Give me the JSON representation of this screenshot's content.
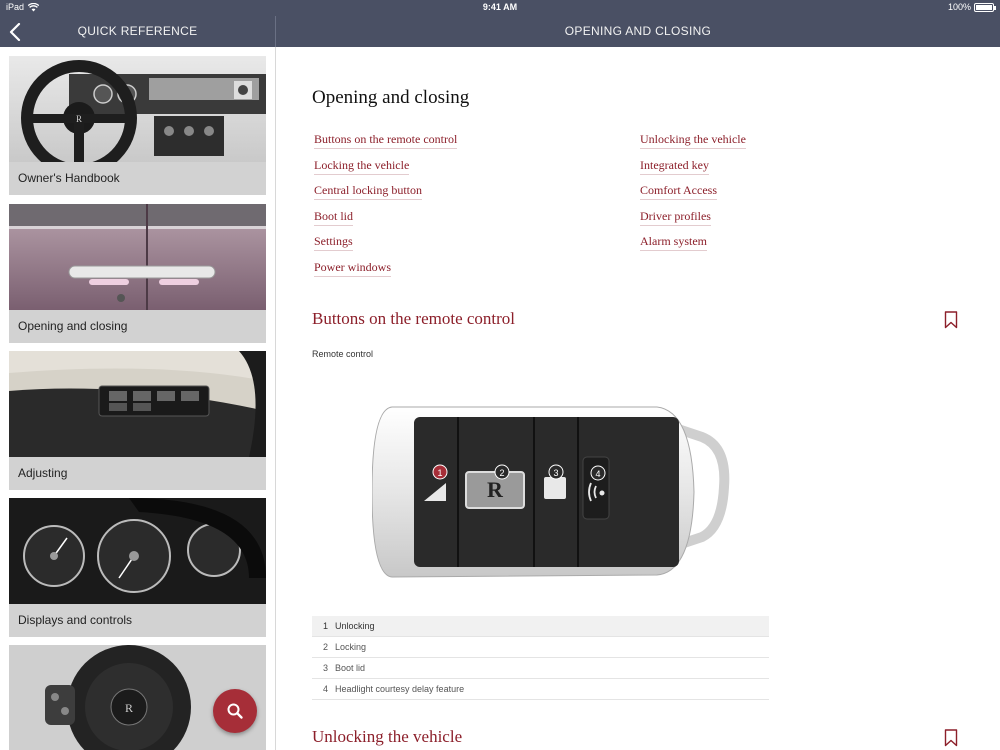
{
  "status_bar": {
    "carrier": "iPad",
    "time": "9:41 AM",
    "battery": "100%"
  },
  "nav": {
    "left_title": "QUICK REFERENCE",
    "right_title": "OPENING AND CLOSING"
  },
  "sidebar": {
    "items": [
      {
        "label": "Owner's Handbook"
      },
      {
        "label": "Opening and closing"
      },
      {
        "label": "Adjusting"
      },
      {
        "label": "Displays and controls"
      }
    ]
  },
  "main": {
    "page_title": "Opening and closing",
    "toc_left": [
      "Buttons on the remote control",
      "Locking the vehicle",
      "Central locking button",
      "Boot lid",
      "Settings",
      "Power windows"
    ],
    "toc_right": [
      "Unlocking the vehicle",
      "Integrated key",
      "Comfort Access",
      "Driver profiles",
      "Alarm system"
    ],
    "section1_title": "Buttons on the remote control",
    "figure_label": "Remote control",
    "fob_callouts": [
      "1",
      "2",
      "3",
      "4"
    ],
    "legend": [
      {
        "num": "1",
        "text": "Unlocking"
      },
      {
        "num": "2",
        "text": "Locking"
      },
      {
        "num": "3",
        "text": "Boot lid"
      },
      {
        "num": "4",
        "text": "Headlight courtesy delay feature"
      }
    ],
    "section2_title": "Unlocking the vehicle"
  },
  "colors": {
    "nav_bg": "#4a5064",
    "accent": "#8c1f2a",
    "fab": "#a62e38"
  },
  "icons": [
    "wifi-icon",
    "battery-icon",
    "back-chevron-icon",
    "search-icon",
    "bookmark-icon"
  ]
}
